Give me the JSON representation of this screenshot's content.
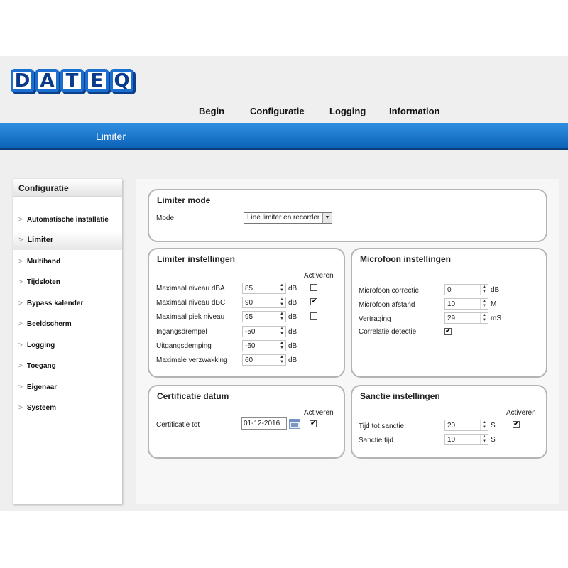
{
  "logo": {
    "letters": [
      "D",
      "A",
      "T",
      "E",
      "Q"
    ]
  },
  "nav": {
    "begin": "Begin",
    "configuratie": "Configuratie",
    "logging": "Logging",
    "information": "Information"
  },
  "page_heading": "Limiter",
  "sidebar": {
    "title": "Configuratie",
    "items": [
      {
        "label": "Automatische installatie"
      },
      {
        "label": "Limiter",
        "active": true
      },
      {
        "label": "Multiband"
      },
      {
        "label": "Tijdsloten"
      },
      {
        "label": "Bypass kalender"
      },
      {
        "label": "Beeldscherm"
      },
      {
        "label": "Logging"
      },
      {
        "label": "Toegang"
      },
      {
        "label": "Eigenaar"
      },
      {
        "label": "Systeem"
      }
    ]
  },
  "limiter_mode": {
    "title": "Limiter mode",
    "mode_label": "Mode",
    "mode_value": "Line limiter en recorder"
  },
  "limiter_instellingen": {
    "title": "Limiter instellingen",
    "activeren_header": "Activeren",
    "rows": [
      {
        "label": "Maximaal niveau dBA",
        "value": "85",
        "unit": "dB",
        "checked": false
      },
      {
        "label": "Maximaal niveau dBC",
        "value": "90",
        "unit": "dB",
        "checked": true
      },
      {
        "label": "Maximaal piek niveau",
        "value": "95",
        "unit": "dB",
        "checked": false
      },
      {
        "label": "Ingangsdrempel",
        "value": "-50",
        "unit": "dB"
      },
      {
        "label": "Uitgangsdemping",
        "value": "-60",
        "unit": "dB"
      },
      {
        "label": "Maximale verzwakking",
        "value": "60",
        "unit": "dB"
      }
    ]
  },
  "microfoon_instellingen": {
    "title": "Microfoon instellingen",
    "rows": [
      {
        "label": "Microfoon correctie",
        "value": "0",
        "unit": "dB"
      },
      {
        "label": "Microfoon afstand",
        "value": "10",
        "unit": "M"
      },
      {
        "label": "Vertraging",
        "value": "29",
        "unit": "mS"
      }
    ],
    "correlatie_label": "Correlatie detectie",
    "correlatie_checked": true
  },
  "certificatie_datum": {
    "title": "Certificatie datum",
    "activeren_header": "Activeren",
    "label": "Certificatie tot",
    "date_value": "01-12-2016",
    "checked": true
  },
  "sanctie_instellingen": {
    "title": "Sanctie instellingen",
    "activeren_header": "Activeren",
    "rows": [
      {
        "label": "Tijd tot sanctie",
        "value": "20",
        "unit": "S",
        "checked": true
      },
      {
        "label": "Sanctie tijd",
        "value": "10",
        "unit": "S"
      }
    ]
  },
  "icons": {
    "checkmark": "✔",
    "spin_up": "▲",
    "spin_down": "▼",
    "dropdown": "▼",
    "chevron": ">"
  }
}
